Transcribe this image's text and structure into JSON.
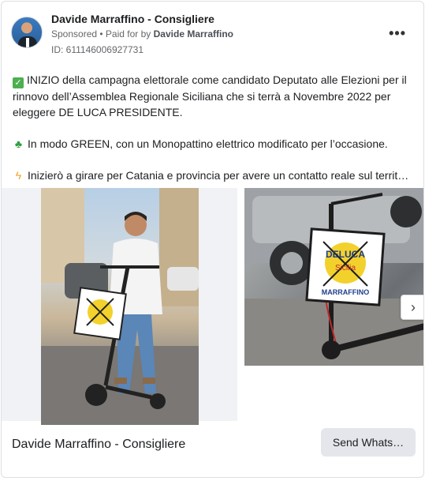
{
  "post": {
    "page_name": "Davide Marraffino - Consigliere",
    "sponsored": "Sponsored",
    "paid_for_prefix": "• Paid for by",
    "paid_for_name": "Davide Marraffino",
    "ad_id": "ID: 611146006927731",
    "more_label": "•••"
  },
  "body": {
    "p1": "INIZIO della campagna elettorale come candidato Deputato alle Elezioni per il rinnovo dell’Assemblea Regionale Siciliana che si terrà a Novembre 2022 per eleggere DE LUCA PRESIDENTE.",
    "p2": "In modo GREEN, con un Monopattino elettrico modificato per l’occasione.",
    "p3": "Inizierò a girare per Catania e provincia per avere un contatto reale sul territori…"
  },
  "icons": {
    "check": "check-mark-icon",
    "clover": "four-leaf-clover-icon",
    "bolt": "lightning-icon",
    "next": "chevron-right-icon"
  },
  "sign": {
    "line1": "DELUCA",
    "line2": "Sicilia",
    "line3": "MARRAFFINO"
  },
  "footer": {
    "page_name": "Davide Marraffino - Consigliere",
    "cta_label": "Send Whats…"
  }
}
